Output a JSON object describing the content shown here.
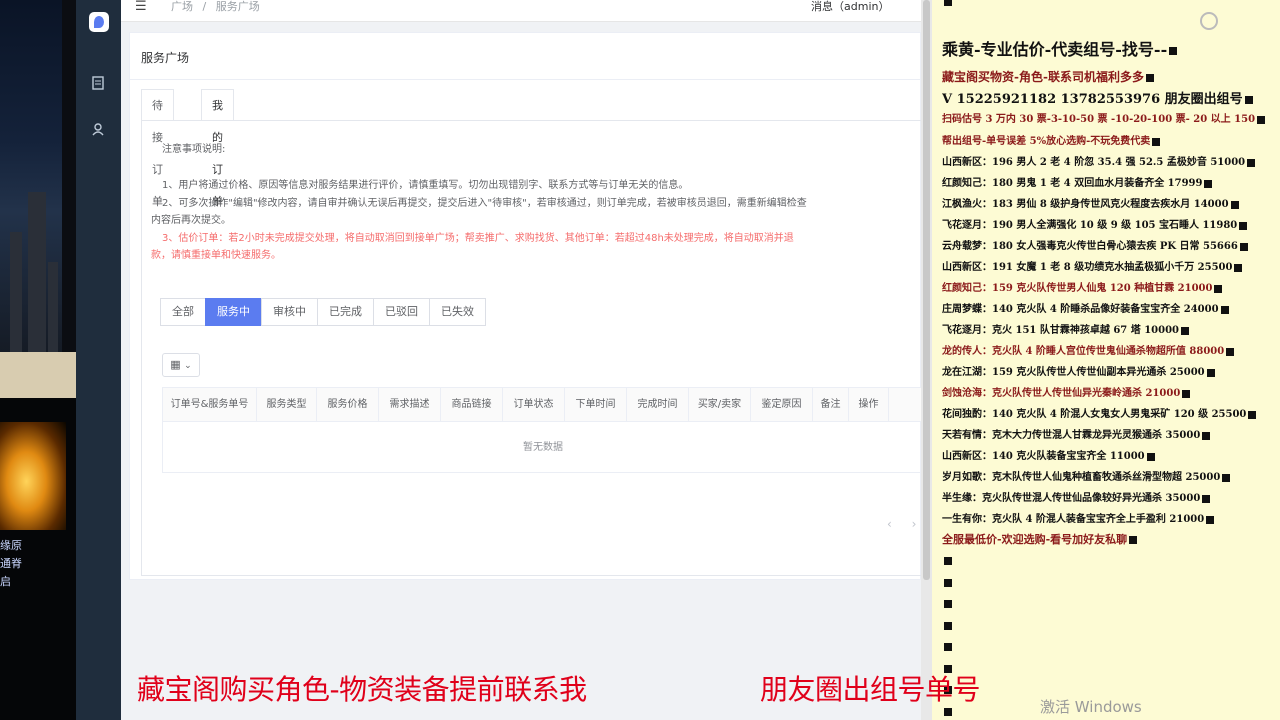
{
  "breadcrumb": {
    "home": "广场",
    "sep": "/",
    "current": "服务广场"
  },
  "header": {
    "user": "消息（admin）"
  },
  "card": {
    "title": "服务广场"
  },
  "tabs": [
    {
      "label": "待接订单"
    },
    {
      "label": "我的订单"
    }
  ],
  "notice": {
    "title": "注意事项说明:",
    "items": [
      "1、用户将通过价格、原因等信息对服务结果进行评价，请慎重填写。切勿出现错别字、联系方式等与订单无关的信息。",
      "2、可多次操作\"编辑\"修改内容，请自审并确认无误后再提交，提交后进入\"待审核\"，若审核通过，则订单完成，若被审核员退回，需重新编辑检查",
      "内容后再次提交。",
      "3、估价订单：若2小时未完成提交处理，将自动取消回到接单广场；帮卖推广、求购找货、其他订单：若超过48h未处理完成，将自动取消并退",
      "款，请慎重接单和快速服务。"
    ]
  },
  "filters": [
    "全部",
    "服务中",
    "审核中",
    "已完成",
    "已驳回",
    "已失效"
  ],
  "table": {
    "columns": [
      "订单号&服务单号",
      "服务类型",
      "服务价格",
      "需求描述",
      "商品链接",
      "订单状态",
      "下单时间",
      "完成时间",
      "买家/卖家",
      "鉴定原因",
      "备注",
      "操作"
    ],
    "empty": "暂无数据"
  },
  "pager": {
    "prev": "‹",
    "next": "›"
  },
  "left_game": {
    "lines": [
      "缘原",
      "通脊",
      "启"
    ]
  },
  "right_panel": {
    "lines": [
      {
        "text": "乘黄-专业估价-代卖组号-找号--",
        "color": "#111",
        "size": 16
      },
      {
        "text": "藏宝阁买物资-角色-联系司机福利多多",
        "color": "#8b1a1a",
        "size": 12
      },
      {
        "text": "V 15225921182   13782553976 朋友圈出组号",
        "color": "#111",
        "size": 13
      },
      {
        "text": "扫码估号 3 万内 30 票-3-10-50 票  -10-20-100 票- 20 以上 150",
        "color": "#8b1a1a",
        "size": 10
      },
      {
        "text": "帮出组号-单号误差 5%放心选购-不玩免费代卖",
        "color": "#8b1a1a",
        "size": 10
      },
      {
        "text": "山西新区：196 男人 2 老 4 阶忽 35.4 强 52.5 孟极妙音 51000",
        "color": "#111",
        "size": 10
      },
      {
        "text": "红颜知己：180 男鬼 1 老 4 双回血水月装备齐全 17999",
        "color": "#111",
        "size": 10
      },
      {
        "text": "江枫渔火：183 男仙 8 级护身传世风克火程度去疾水月 14000",
        "color": "#111",
        "size": 10
      },
      {
        "text": "飞花逐月：190 男人全满强化 10 级 9 级 105 宝石睡人 11980",
        "color": "#111",
        "size": 10
      },
      {
        "text": "云舟载梦：180 女人强毒克火传世白骨心猿去疾 PK 日常 55666",
        "color": "#111",
        "size": 10
      },
      {
        "text": "山西新区：191 女魔 1 老 8 级功绩克水抽孟极狐小千万 25500",
        "color": "#111",
        "size": 10
      },
      {
        "text": "红颜知己：159 克火队传世男人仙鬼 120 种植甘霖 21000",
        "color": "#8b1a1a",
        "size": 10
      },
      {
        "text": "庄周梦蝶：140 克火队 4 阶睡杀品像好装备宝宝齐全 24000",
        "color": "#111",
        "size": 10
      },
      {
        "text": "飞花逐月：克火 151 队甘霖神孩卓越 67 塔 10000",
        "color": "#111",
        "size": 10
      },
      {
        "text": "龙的传人：克火队 4 阶睡人宫位传世鬼仙通杀物超所值 88000",
        "color": "#8b1a1a",
        "size": 10
      },
      {
        "text": "龙在江湖：159 克火队传世人传世仙副本异光通杀 25000",
        "color": "#111",
        "size": 10
      },
      {
        "text": "剑蚀沧海：克火队传世人传世仙异光秦岭通杀 21000",
        "color": "#8b1a1a",
        "size": 10
      },
      {
        "text": "花间独酌：140 克火队 4 阶混人女鬼女人男鬼采矿 120 级 25500",
        "color": "#111",
        "size": 10
      },
      {
        "text": "天若有情：克木大力传世混人甘霖龙异光灵猴通杀 35000",
        "color": "#111",
        "size": 10
      },
      {
        "text": "山西新区：140 克火队装备宝宝齐全 11000",
        "color": "#111",
        "size": 10
      },
      {
        "text": "岁月如歌：克木队传世人仙鬼种植畜牧通杀丝滑型物超 25000",
        "color": "#111",
        "size": 10
      },
      {
        "text": "半生缘：克火队传世混人传世仙品像较好异光通杀 35000",
        "color": "#111",
        "size": 10
      },
      {
        "text": "一生有你：克火队 4 阶混人装备宝宝齐全上手盈利 21000",
        "color": "#111",
        "size": 10
      },
      {
        "text": "全服最低价-欢迎选购-看号加好友私聊",
        "color": "#8b1a1a",
        "size": 11
      }
    ]
  },
  "overlay": {
    "left": "藏宝阁购买角色-物资装备提前联系我",
    "right": "朋友圈出组号单号"
  },
  "watermark": "激活 Windows"
}
